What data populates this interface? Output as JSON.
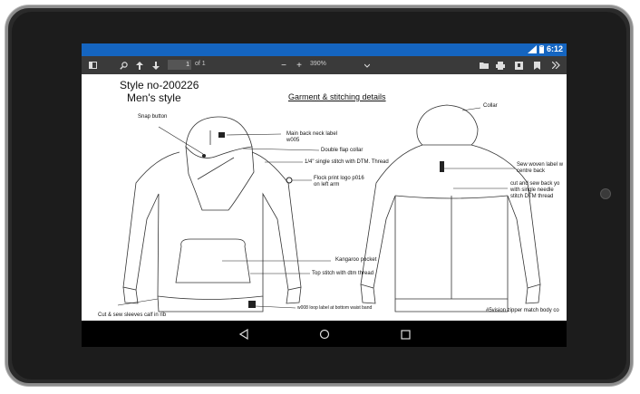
{
  "status": {
    "time": "6:12"
  },
  "toolbar": {
    "page_value": "1",
    "page_of": "of 1",
    "zoom": "390%",
    "minus": "−",
    "plus": "+"
  },
  "document": {
    "style_no": "Style no-200226",
    "style_name": "Men's style",
    "heading": "Garment & stitching details",
    "labels": {
      "snap_button": "Snap button",
      "main_label_1": "Main back neck label",
      "main_label_2": "w005",
      "double_flap": "Double flap collar",
      "single_stitch": "1/4\" single stitch with DTM. Thread",
      "flock_1": "Flock print logo p016",
      "flock_2": "on left arm",
      "kangaroo": "Kangaroo pocket",
      "top_stitch": "Top stitch with dtm thread",
      "cut_sew_sleeves": "Cut & sew sleeves calf in rib",
      "loop_label": "w008 loop label at bottom waist band",
      "collar": "Collar",
      "woven_1": "Sew woven label w",
      "woven_2": "centre back",
      "cut_back_1": "cut and sew back yo",
      "cut_back_2": "with single needle",
      "cut_back_3": "stitch DTM thread",
      "zipper": "#5vision zipper match body co"
    }
  },
  "colors": {
    "status_bar": "#1565c0",
    "toolbar": "#3a3a3a",
    "page": "#ffffff"
  }
}
